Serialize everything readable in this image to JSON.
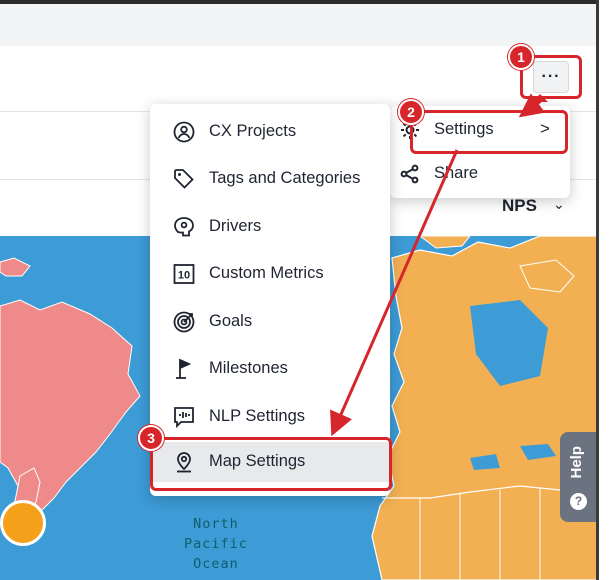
{
  "toolbar": {
    "more_label": "···"
  },
  "filter": {
    "metric": "NPS",
    "chevron": "⌄"
  },
  "main_menu": {
    "items": [
      {
        "label": "CX Projects",
        "icon": "cx-projects-icon"
      },
      {
        "label": "Tags and Categories",
        "icon": "tag-icon"
      },
      {
        "label": "Drivers",
        "icon": "drivers-icon"
      },
      {
        "label": "Custom Metrics",
        "icon": "custom-metrics-icon"
      },
      {
        "label": "Goals",
        "icon": "target-icon"
      },
      {
        "label": "Milestones",
        "icon": "flag-icon"
      },
      {
        "label": "NLP Settings",
        "icon": "nlp-icon"
      },
      {
        "label": "Map Settings",
        "icon": "map-pin-icon"
      }
    ]
  },
  "sub_menu": {
    "items": [
      {
        "label": "Settings",
        "icon": "gear-icon",
        "chevron": ">"
      },
      {
        "label": "Share",
        "icon": "share-icon"
      }
    ]
  },
  "map": {
    "ocean_label_lines": [
      "North",
      "Pacific",
      "Ocean"
    ]
  },
  "help": {
    "label": "Help",
    "icon_glyph": "?"
  },
  "annotations": {
    "steps": [
      "1",
      "2",
      "3"
    ],
    "color": "#d7262b"
  },
  "colors": {
    "ocean": "#3d9bd6",
    "land_orange": "#f2b053",
    "land_red": "#ee8a8a",
    "marker": "#f5a01a"
  }
}
